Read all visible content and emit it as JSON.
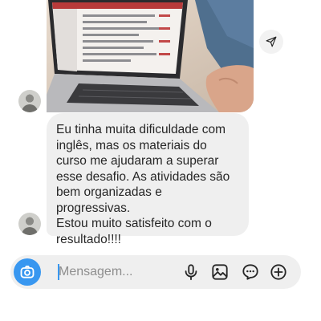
{
  "conversation": {
    "message_text": "Eu tinha muita dificuldade com inglês, mas os materiais do curso me ajudaram a superar esse desafio. As atividades são bem organizadas e progressivas. Estou muito satisfeito com o resultado!!!!",
    "message_lines": [
      "Eu tinha muita dificuldade com",
      "inglês, mas os materiais do",
      "curso me ajudaram a superar",
      "esse desafio. As atividades são",
      "bem organizadas e progressivas.",
      "Estou muito satisfeito com o",
      "resultado!!!!"
    ],
    "share_icon": "send-arrow-icon"
  },
  "composer": {
    "placeholder": "Mensagem...",
    "value": "",
    "icons": [
      "camera-icon",
      "microphone-icon",
      "gallery-icon",
      "sticker-icon",
      "plus-icon"
    ]
  },
  "colors": {
    "accent": "#3897f0",
    "bubble": "#efefef",
    "text": "#262626",
    "placeholder": "#8e8e8e"
  }
}
